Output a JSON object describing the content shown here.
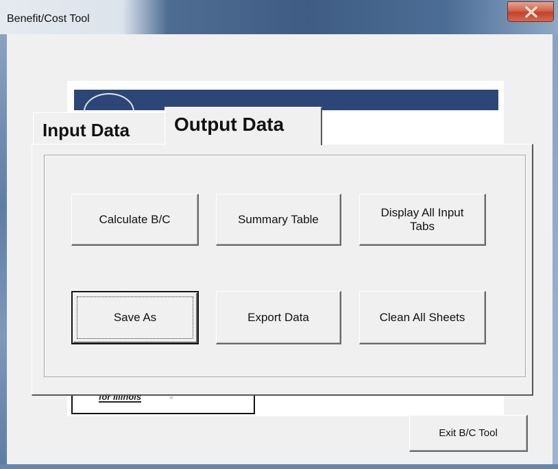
{
  "window": {
    "title": "Benefit/Cost Tool",
    "close_icon": "close-x-icon"
  },
  "logo": {
    "text": "for Illinois",
    "mark": "«"
  },
  "tabs": [
    {
      "label": "Input Data",
      "selected": false
    },
    {
      "label": "Output Data",
      "selected": true
    }
  ],
  "buttons": {
    "calculate": "Calculate B/C",
    "summary": "Summary Table",
    "display_all": "Display All Input Tabs",
    "save_as": "Save As",
    "export": "Export Data",
    "clean": "Clean All Sheets",
    "exit": "Exit B/C Tool"
  }
}
